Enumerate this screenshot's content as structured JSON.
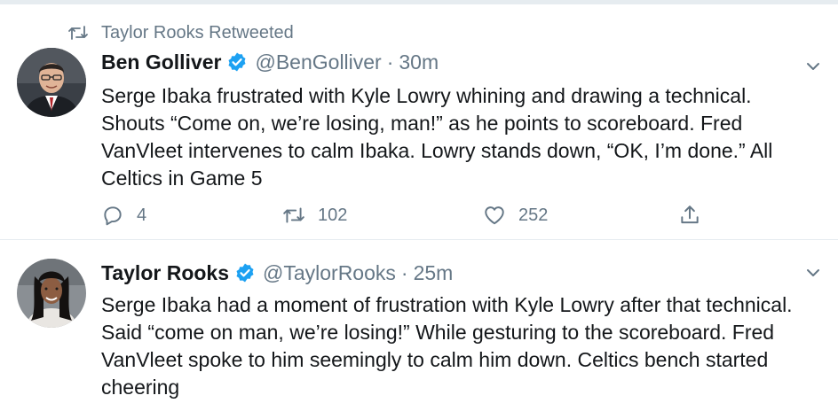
{
  "retweet_context": {
    "text": "Taylor Rooks Retweeted"
  },
  "tweets": [
    {
      "author_name": "Ben Golliver",
      "handle": "@BenGolliver",
      "separator": "·",
      "time": "30m",
      "text": "Serge Ibaka frustrated with Kyle Lowry whining and drawing a technical. Shouts “Come on, we’re losing, man!” as he points to scoreboard. Fred VanVleet intervenes to calm Ibaka. Lowry stands down, “OK, I’m done.” All Celtics in Game 5",
      "replies": "4",
      "retweets": "102",
      "likes": "252"
    },
    {
      "author_name": "Taylor Rooks",
      "handle": "@TaylorRooks",
      "separator": "·",
      "time": "25m",
      "text": "Serge Ibaka had a moment of frustration with Kyle Lowry after that technical. Said “come on man, we’re losing!” While gesturing to the scoreboard. Fred VanVleet spoke to him seemingly to calm him down. Celtics bench started cheering"
    }
  ],
  "colors": {
    "text": "#14171a",
    "muted": "#657786",
    "verified": "#1da1f2",
    "divider": "#e6ecf0"
  }
}
